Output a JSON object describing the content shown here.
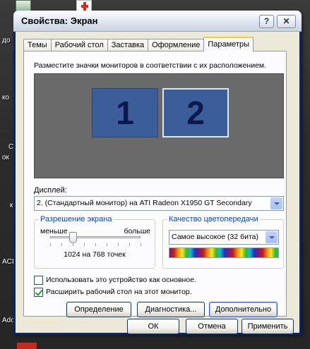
{
  "desktop": {
    "labels": [
      "до",
      "ко",
      "С",
      "ок",
      "к",
      "ACI",
      "Ado"
    ]
  },
  "window": {
    "title": "Свойства: Экран",
    "help_glyph": "?",
    "close_glyph": "✕"
  },
  "tabs": [
    {
      "label": "Темы",
      "active": false
    },
    {
      "label": "Рабочий стол",
      "active": false
    },
    {
      "label": "Заставка",
      "active": false
    },
    {
      "label": "Оформление",
      "active": false
    },
    {
      "label": "Параметры",
      "active": true
    }
  ],
  "settings": {
    "instruction": "Разместите значки мониторов в соответствии с их расположением.",
    "monitors": [
      "1",
      "2"
    ],
    "selected_monitor": "2",
    "display_label": "Дисплей:",
    "display_value": "2. (Стандартный монитор) на ATI Radeon X1950 GT Secondary",
    "resolution": {
      "title": "Разрешение экрана",
      "less": "меньше",
      "more": "больше",
      "value": "1024 на 768 точек",
      "slider_position": 0.25
    },
    "color_quality": {
      "title": "Качество цветопередачи",
      "value": "Самое высокое (32 бита)"
    },
    "checkbox_primary": {
      "label": "Использовать это устройство как основное.",
      "checked": false
    },
    "checkbox_extend": {
      "label": "Расширить рабочий стол на этот монитор.",
      "checked": true
    },
    "buttons": {
      "identify": "Определение",
      "troubleshoot": "Диагностика...",
      "advanced": "Дополнительно"
    }
  },
  "footer": {
    "ok": "ОК",
    "cancel": "Отмена",
    "apply": "Применить"
  },
  "colors": {
    "monitor_fill": "#3b5d9a",
    "group_title": "#0046d5",
    "title_bar": "#e9eef6"
  }
}
